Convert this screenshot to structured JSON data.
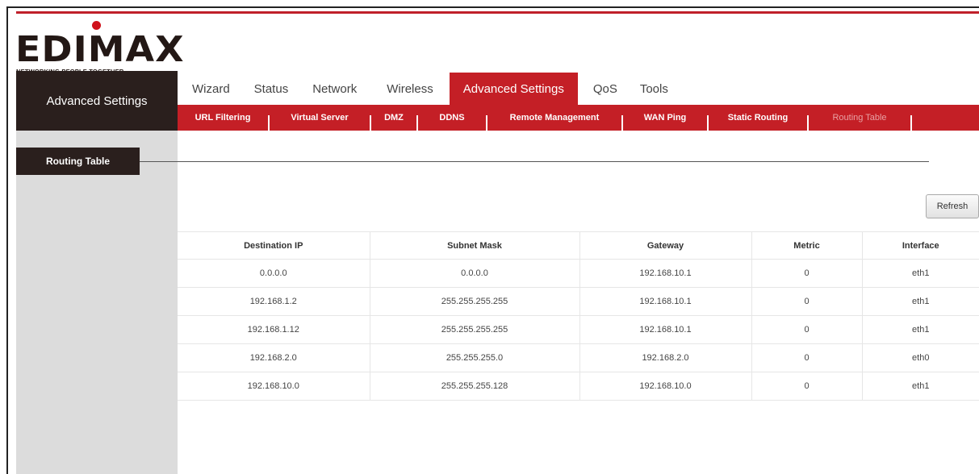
{
  "brand": {
    "logo_text": "EDIMAX",
    "tagline": "NETWORKING PEOPLE TOGETHER",
    "accent": "#c41f26",
    "dark": "#2a1f1d"
  },
  "sidebar": {
    "header": "Advanced Settings",
    "items": [
      {
        "label": "Routing Table"
      }
    ]
  },
  "main_tabs": [
    {
      "label": "Wizard"
    },
    {
      "label": "Status"
    },
    {
      "label": "Network"
    },
    {
      "label": "Wireless"
    },
    {
      "label": "Advanced Settings",
      "active": true
    },
    {
      "label": "QoS"
    },
    {
      "label": "Tools"
    }
  ],
  "sub_tabs": [
    {
      "label": "URL Filtering"
    },
    {
      "label": "Virtual Server"
    },
    {
      "label": "DMZ"
    },
    {
      "label": "DDNS"
    },
    {
      "label": "Remote Management"
    },
    {
      "label": "WAN Ping"
    },
    {
      "label": "Static Routing"
    },
    {
      "label": "Routing Table",
      "active": true
    }
  ],
  "actions": {
    "refresh_label": "Refresh"
  },
  "routing_table": {
    "columns": [
      "Destination IP",
      "Subnet Mask",
      "Gateway",
      "Metric",
      "Interface"
    ],
    "rows": [
      [
        "0.0.0.0",
        "0.0.0.0",
        "192.168.10.1",
        "0",
        "eth1"
      ],
      [
        "192.168.1.2",
        "255.255.255.255",
        "192.168.10.1",
        "0",
        "eth1"
      ],
      [
        "192.168.1.12",
        "255.255.255.255",
        "192.168.10.1",
        "0",
        "eth1"
      ],
      [
        "192.168.2.0",
        "255.255.255.0",
        "192.168.2.0",
        "0",
        "eth0"
      ],
      [
        "192.168.10.0",
        "255.255.255.128",
        "192.168.10.0",
        "0",
        "eth1"
      ]
    ]
  }
}
